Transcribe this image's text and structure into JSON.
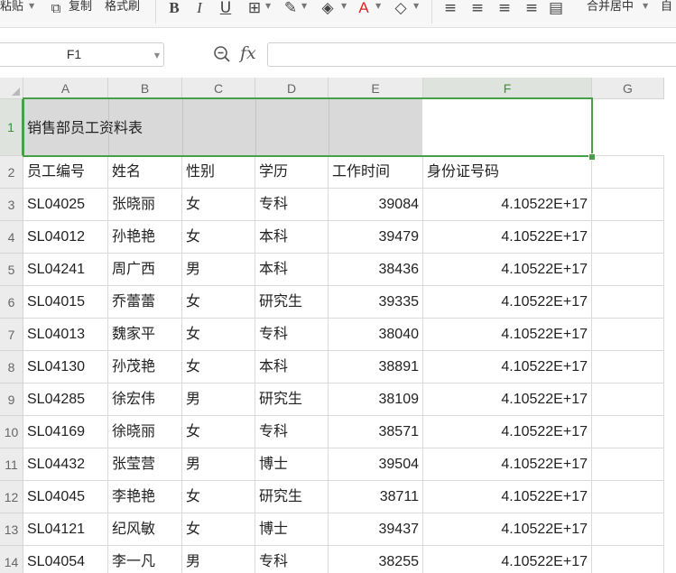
{
  "toolbar": {
    "paste_label": "粘贴",
    "copy_label": "复制",
    "format_painter_label": "格式刷",
    "merge_center_label": "合并居中",
    "auto_label": "自"
  },
  "formula_bar": {
    "name_box": "F1",
    "fx_label": "fx",
    "formula": ""
  },
  "columns": [
    "A",
    "B",
    "C",
    "D",
    "E",
    "F",
    "G"
  ],
  "selected_cell": "F1",
  "title": "销售部员工资料表",
  "header_row": [
    "员工编号",
    "姓名",
    "性别",
    "学历",
    "工作时间",
    "身份证号码"
  ],
  "rows": [
    {
      "num": "1"
    },
    {
      "num": "2"
    },
    {
      "num": "3",
      "cells": [
        "SL04025",
        "张晓丽",
        "女",
        "专科",
        "39084",
        "4.10522E+17"
      ]
    },
    {
      "num": "4",
      "cells": [
        "SL04012",
        "孙艳艳",
        "女",
        "本科",
        "39479",
        "4.10522E+17"
      ]
    },
    {
      "num": "5",
      "cells": [
        "SL04241",
        "周广西",
        "男",
        "本科",
        "38436",
        "4.10522E+17"
      ]
    },
    {
      "num": "6",
      "cells": [
        "SL04015",
        "乔蕾蕾",
        "女",
        "研究生",
        "39335",
        "4.10522E+17"
      ]
    },
    {
      "num": "7",
      "cells": [
        "SL04013",
        "魏家平",
        "女",
        "专科",
        "38040",
        "4.10522E+17"
      ]
    },
    {
      "num": "8",
      "cells": [
        "SL04130",
        "孙茂艳",
        "女",
        "本科",
        "38891",
        "4.10522E+17"
      ]
    },
    {
      "num": "9",
      "cells": [
        "SL04285",
        "徐宏伟",
        "男",
        "研究生",
        "38109",
        "4.10522E+17"
      ]
    },
    {
      "num": "10",
      "cells": [
        "SL04169",
        "徐晓丽",
        "女",
        "专科",
        "38571",
        "4.10522E+17"
      ]
    },
    {
      "num": "11",
      "cells": [
        "SL04432",
        "张莹营",
        "男",
        "博士",
        "39504",
        "4.10522E+17"
      ]
    },
    {
      "num": "12",
      "cells": [
        "SL04045",
        "李艳艳",
        "女",
        "研究生",
        "38711",
        "4.10522E+17"
      ]
    },
    {
      "num": "13",
      "cells": [
        "SL04121",
        "纪风敏",
        "女",
        "博士",
        "39437",
        "4.10522E+17"
      ]
    },
    {
      "num": "14",
      "cells": [
        "SL04054",
        "李一凡",
        "男",
        "专科",
        "38255",
        "4.10522E+17"
      ]
    }
  ]
}
